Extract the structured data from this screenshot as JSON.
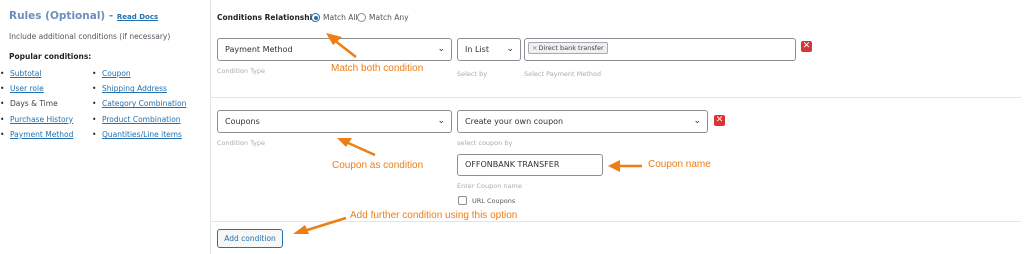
{
  "left": {
    "title": "Rules (Optional)",
    "dash": " - ",
    "docs_link": "Read Docs",
    "subtitle": "Include additional conditions (if necessary)",
    "popular_heading": "Popular conditions:",
    "col_a": [
      "Subtotal",
      "User role",
      "Days & Time",
      "Purchase History",
      "Payment Method"
    ],
    "col_b": [
      "Coupon",
      "Shipping Address",
      "Category Combination",
      "Product Combination",
      "Quantities/Line items"
    ]
  },
  "relationship": {
    "label": "Conditions Relationship",
    "option_all": "Match All",
    "option_any": "Match Any",
    "selected": "Match All"
  },
  "condition1": {
    "type_value": "Payment Method",
    "type_hint": "Condition Type",
    "operator_value": "In List",
    "operator_hint": "Select by",
    "tag": "Direct bank transfer",
    "tag_remove": "×",
    "value_hint": "Select Payment Method",
    "delete": "✕"
  },
  "condition2": {
    "type_value": "Coupons",
    "type_hint": "Condition Type",
    "operator_value": "Create your own coupon",
    "operator_hint": "select coupon by",
    "coupon_value": "OFFONBANK TRANSFER",
    "coupon_hint": "Enter Coupon name",
    "url_coupons_label": "URL Coupons",
    "delete": "✕"
  },
  "add_button": "Add condition",
  "annotations": {
    "match_both": "Match both condition",
    "coupon_condition": "Coupon as condition",
    "coupon_name": "Coupon name",
    "add_further": "Add further condition using this option"
  },
  "colors": {
    "accent": "#2271b1",
    "annotation": "#ee7d13",
    "delete": "#d63638"
  },
  "icons": {
    "chevron": "chevron-down-icon",
    "delete": "close-icon",
    "arrow": "arrow-icon"
  }
}
